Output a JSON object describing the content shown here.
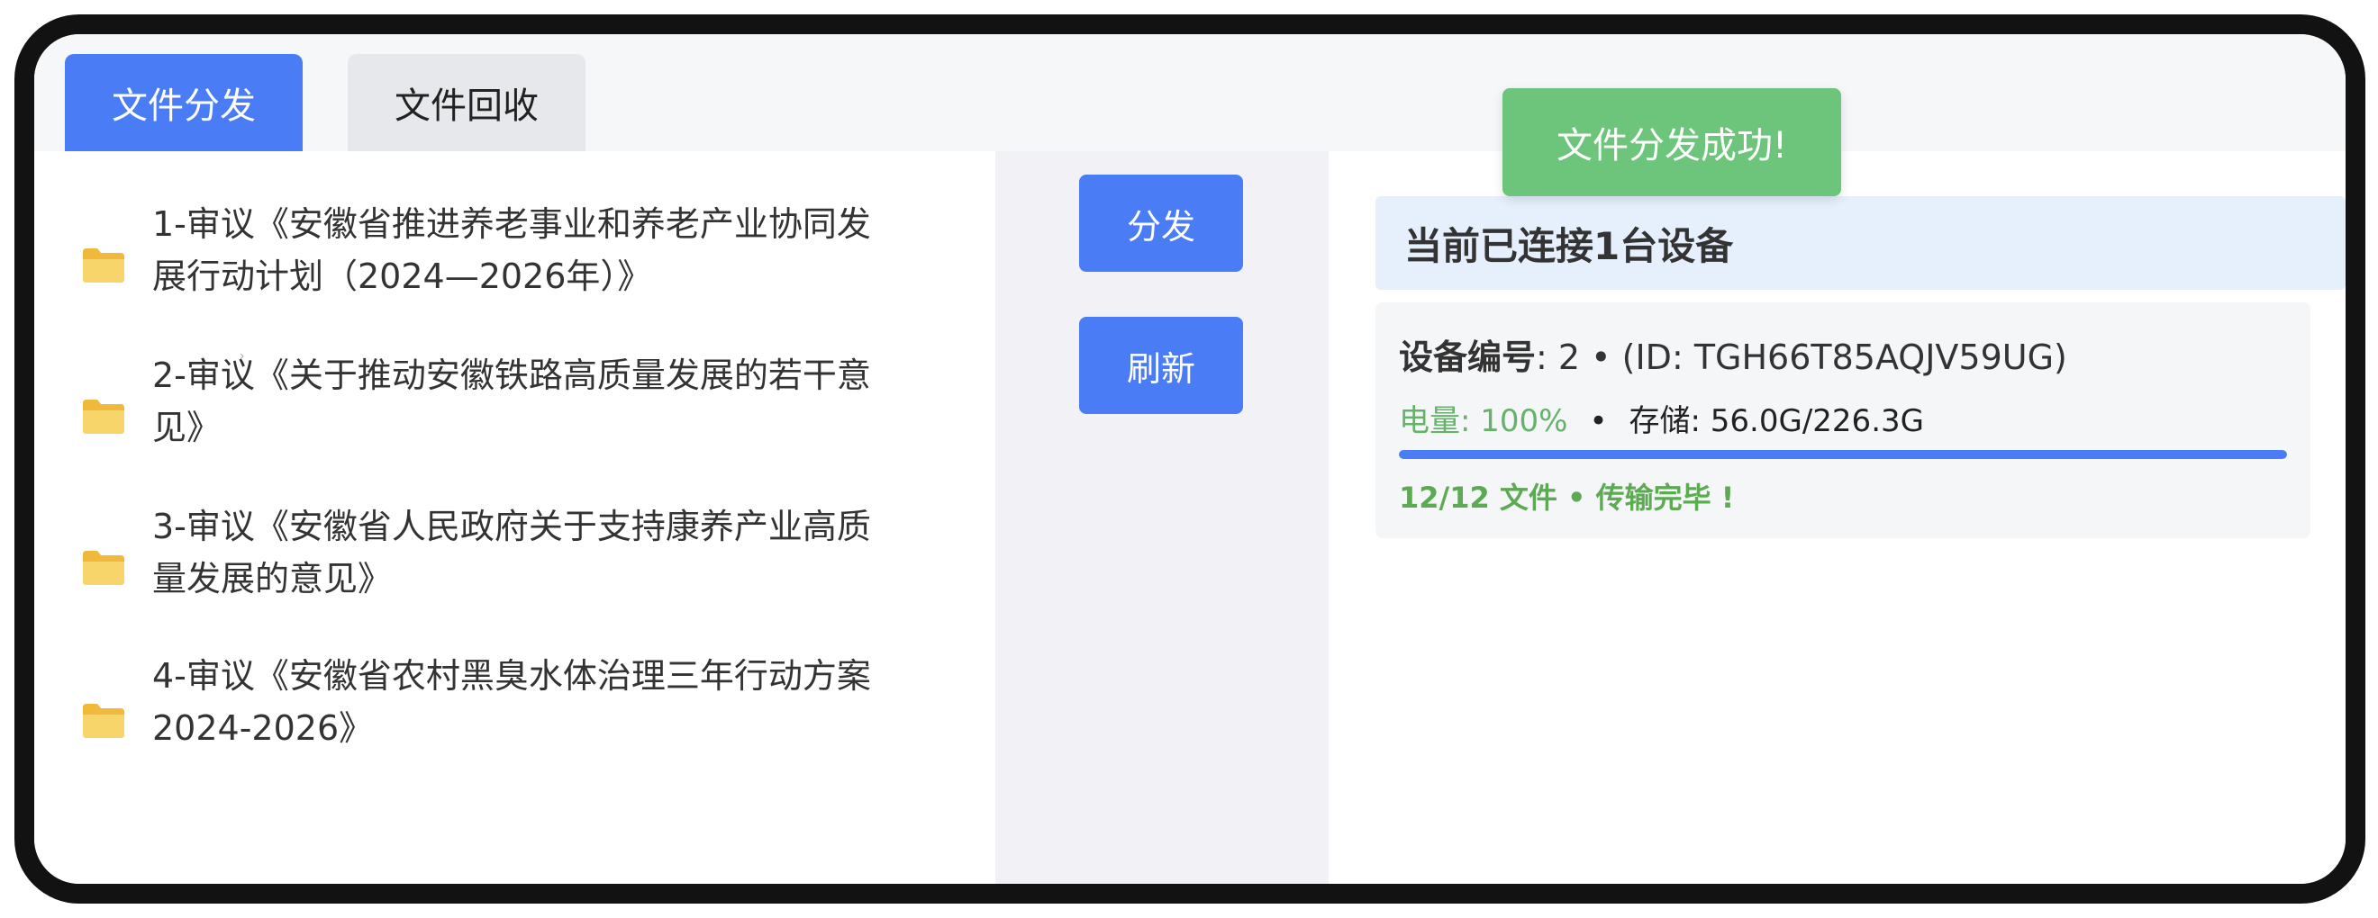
{
  "tabs": [
    {
      "label": "文件分发",
      "active": true
    },
    {
      "label": "文件回收",
      "active": false
    }
  ],
  "files": [
    {
      "lines": [
        "1-审议《安徽省推进养老事业和养老产业协同发",
        "展行动计划（2024—2026年）》"
      ],
      "icon": "folder-icon"
    },
    {
      "lines": [
        "2-审议《关于推动安徽铁路高质量发展的若干意",
        "见》"
      ],
      "icon": "folder-icon"
    },
    {
      "lines": [
        "3-审议《安徽省人民政府关于支持康养产业高质",
        "量发展的意见》"
      ],
      "icon": "folder-icon"
    },
    {
      "lines": [
        "4-审议《安徽省农村黑臭水体治理三年行动方案",
        "2024-2026》"
      ],
      "icon": "folder-icon"
    }
  ],
  "chevron": "›",
  "actions": {
    "distribute_label": "分发",
    "refresh_label": "刷新"
  },
  "devices": {
    "connected_text": "当前已连接1台设备",
    "list": [
      {
        "number_label": "设备编号",
        "number_value": ": 2 • (ID: TGH66T85AQJV59UG)",
        "battery_text": "电量: 100%",
        "separator": "•",
        "storage_text": "存储: 56.0G/226.3G",
        "progress": 1.0,
        "status_text": "12/12 文件 • 传输完毕 !"
      }
    ]
  },
  "toast": {
    "message": "文件分发成功!"
  },
  "colors": {
    "accent": "#4a7cf6",
    "success": "#6cc57a",
    "battery": "#67b26b",
    "folder": "#f5c34b"
  }
}
